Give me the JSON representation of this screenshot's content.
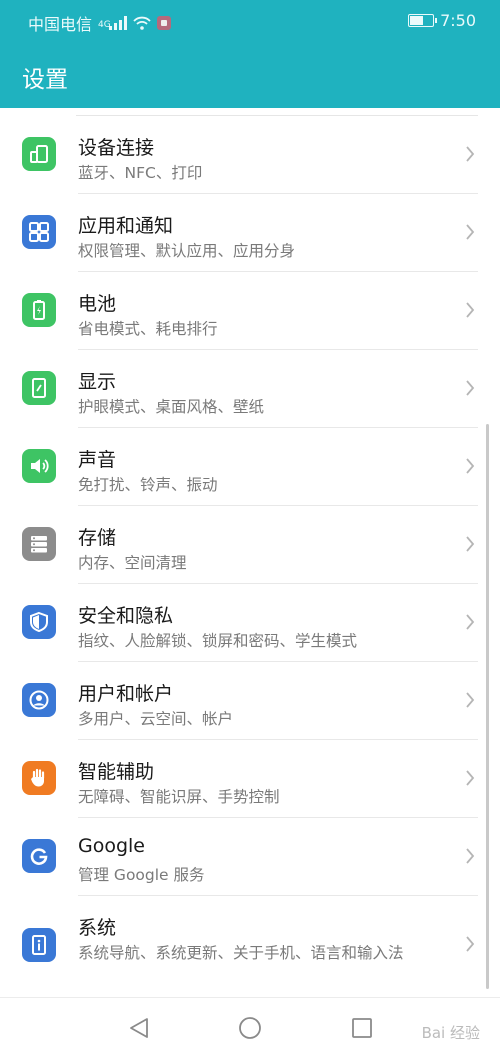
{
  "status": {
    "carrier": "中国电信",
    "network": "4G",
    "time": "7:50",
    "battery_level": 0.6
  },
  "appbar": {
    "title": "设置"
  },
  "items": [
    {
      "title": "设备连接",
      "sub": "蓝牙、NFC、打印",
      "icon": "device-connection-icon",
      "color": "#3ec464"
    },
    {
      "title": "应用和通知",
      "sub": "权限管理、默认应用、应用分身",
      "icon": "apps-grid-icon",
      "color": "#3a78d6"
    },
    {
      "title": "电池",
      "sub": "省电模式、耗电排行",
      "icon": "battery-icon",
      "color": "#3ec464"
    },
    {
      "title": "显示",
      "sub": "护眼模式、桌面风格、壁纸",
      "icon": "display-icon",
      "color": "#3ec464"
    },
    {
      "title": "声音",
      "sub": "免打扰、铃声、振动",
      "icon": "speaker-icon",
      "color": "#3ec464"
    },
    {
      "title": "存储",
      "sub": "内存、空间清理",
      "icon": "storage-icon",
      "color": "#8c8c8c"
    },
    {
      "title": "安全和隐私",
      "sub": "指纹、人脸解锁、锁屏和密码、学生模式",
      "icon": "shield-icon",
      "color": "#3a78d6"
    },
    {
      "title": "用户和帐户",
      "sub": "多用户、云空间、帐户",
      "icon": "user-account-icon",
      "color": "#3a78d6"
    },
    {
      "title": "智能辅助",
      "sub": "无障碍、智能识屏、手势控制",
      "icon": "hand-icon",
      "color": "#f07b22"
    },
    {
      "title": "Google",
      "sub": "管理 Google 服务",
      "icon": "google-icon",
      "color": "#3a78d6"
    },
    {
      "title": "系统",
      "sub": "系统导航、系统更新、关于手机、语言和输入法",
      "icon": "system-info-icon",
      "color": "#3a78d6"
    }
  ],
  "watermark": "Bai 经验"
}
